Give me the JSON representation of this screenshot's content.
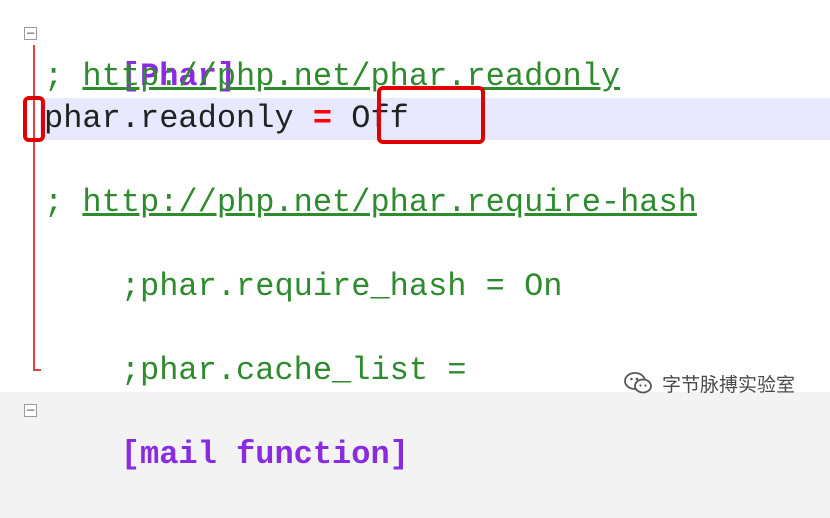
{
  "lines": [
    {
      "section": "[Phar]"
    },
    {
      "comment_prefix": "; ",
      "link": "http://php.net/phar.readonly"
    },
    {
      "key": "phar.readonly ",
      "eq": "=",
      "value": " Off"
    },
    {},
    {
      "comment_prefix": "; ",
      "link": "http://php.net/phar.require-hash"
    },
    {
      "comment": ";phar.require_hash = On"
    },
    {},
    {
      "comment": ";phar.cache_list ="
    },
    {},
    {
      "section": "[mail function]"
    }
  ],
  "watermark": {
    "text": "字节脉搏实验室",
    "icon": "wechat-icon"
  },
  "colors": {
    "section": "#8a2be2",
    "comment": "#2e8b2e",
    "equals": "#ff0000",
    "highlight": "#e8e8ff",
    "annotation": "#e00000"
  }
}
